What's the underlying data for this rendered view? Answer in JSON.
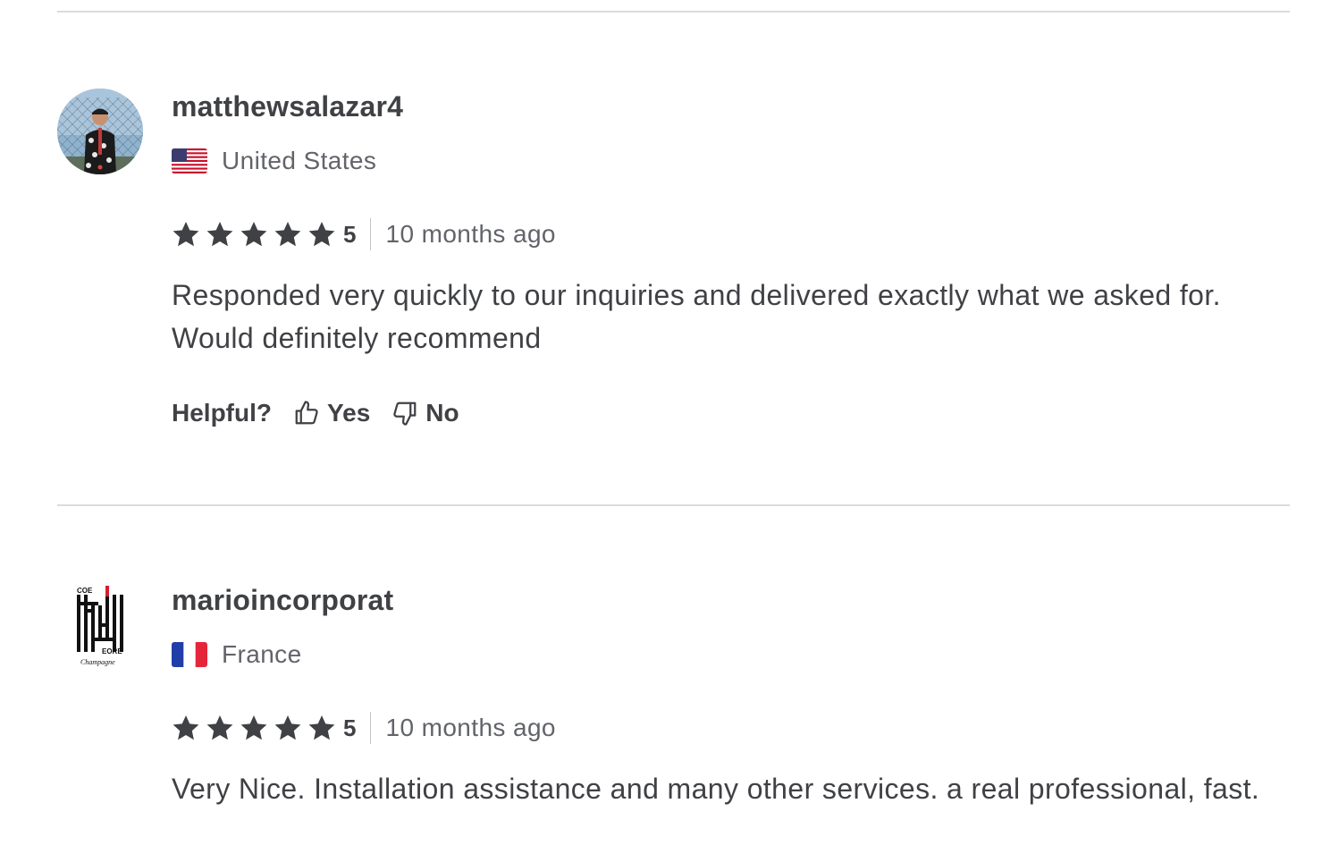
{
  "reviews": [
    {
      "username": "matthewsalazar4",
      "country": "United States",
      "flag": "us-flag",
      "rating": 5,
      "rating_label": "5",
      "time": "10 months ago",
      "text": "Responded very quickly to our inquiries and delivered exactly what we asked for. Would definitely recommend",
      "helpful_label": "Helpful?",
      "yes_label": "Yes",
      "no_label": "No"
    },
    {
      "username": "marioincorporat",
      "country": "France",
      "flag": "fr-flag",
      "rating": 5,
      "rating_label": "5",
      "time": "10 months ago",
      "text": "Very Nice. Installation assistance and many other services. a real professional, fast.",
      "logo_text": [
        "COE",
        "EORE",
        "Champagne"
      ]
    }
  ],
  "colors": {
    "star": "#404145",
    "divider": "#dadbdd",
    "text": "#404145",
    "muted": "#62646a"
  }
}
